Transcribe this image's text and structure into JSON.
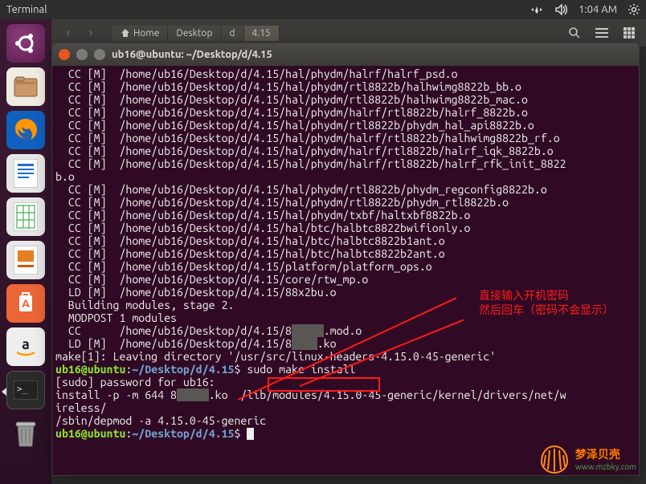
{
  "menubar": {
    "app": "Terminal",
    "time": "1:04 AM"
  },
  "fm": {
    "breadcrumb": [
      "Home",
      "Desktop",
      "d",
      "4.15"
    ]
  },
  "launcher": {
    "items": [
      "ubuntu-dash",
      "files",
      "firefox",
      "writer",
      "calc",
      "impress",
      "software",
      "amazon",
      "terminal",
      "trash"
    ]
  },
  "terminal": {
    "title": "ub16@ubuntu: ~/Desktop/d/4.15",
    "prompt_user": "ub16@ubuntu",
    "prompt_path": "~/Desktop/d/4.15",
    "prompt_sep": ":",
    "prompt_end": "$",
    "lines": [
      "  CC [M]  /home/ub16/Desktop/d/4.15/hal/phydm/halrf/halrf_psd.o",
      "  CC [M]  /home/ub16/Desktop/d/4.15/hal/phydm/rtl8822b/halhwimg8822b_bb.o",
      "  CC [M]  /home/ub16/Desktop/d/4.15/hal/phydm/rtl8822b/halhwimg8822b_mac.o",
      "  CC [M]  /home/ub16/Desktop/d/4.15/hal/phydm/halrf/rtl8822b/halrf_8822b.o",
      "  CC [M]  /home/ub16/Desktop/d/4.15/hal/phydm/rtl8822b/phydm_hal_api8822b.o",
      "  CC [M]  /home/ub16/Desktop/d/4.15/hal/phydm/halrf/rtl8822b/halhwimg8822b_rf.o",
      "  CC [M]  /home/ub16/Desktop/d/4.15/hal/phydm/halrf/rtl8822b/halrf_iqk_8822b.o",
      "  CC [M]  /home/ub16/Desktop/d/4.15/hal/phydm/halrf/rtl8822b/halrf_rfk_init_8822",
      "b.o",
      "  CC [M]  /home/ub16/Desktop/d/4.15/hal/phydm/rtl8822b/phydm_regconfig8822b.o",
      "  CC [M]  /home/ub16/Desktop/d/4.15/hal/phydm/rtl8822b/phydm_rtl8822b.o",
      "  CC [M]  /home/ub16/Desktop/d/4.15/hal/phydm/txbf/haltxbf8822b.o",
      "  CC [M]  /home/ub16/Desktop/d/4.15/hal/btc/halbtc8822bwifionly.o",
      "  CC [M]  /home/ub16/Desktop/d/4.15/hal/btc/halbtc8822b1ant.o",
      "  CC [M]  /home/ub16/Desktop/d/4.15/hal/btc/halbtc8822b2ant.o",
      "  CC [M]  /home/ub16/Desktop/d/4.15/platform/platform_ops.o",
      "  CC [M]  /home/ub16/Desktop/d/4.15/core/rtw_mp.o",
      "  LD [M]  /home/ub16/Desktop/d/4.15/88x2bu.o",
      "  Building modules, stage 2.",
      "  MODPOST 1 modules",
      "  LD [M]  /home/ub16/Desktop/d/4.15/8",
      "make[1]: Leaving directory '/usr/src/linux-headers-4.15.0-45-generic'"
    ],
    "line_cc_mod": "  CC      /home/ub16/Desktop/d/4.15/8",
    "line_cc_mod_tail": ".mod.o",
    "line_ld_mod_tail": ".ko",
    "cmd1": "sudo make install",
    "sudo_line": "[sudo] password for ub16:",
    "install_line_a": "install -p -m 644 8",
    "install_line_b": ".ko  /lib/modules/4.15.0-45-generic/kernel/drivers/net/w",
    "install_line2": "ireless/",
    "depmod_line": "/sbin/depmod -a 4.15.0-45-generic"
  },
  "annotation": {
    "line1": "直接输入开机密码",
    "line2": "然后回车（密码不会显示）"
  },
  "watermark": {
    "title": "梦泽贝壳",
    "url": "www.mzbky.com"
  }
}
